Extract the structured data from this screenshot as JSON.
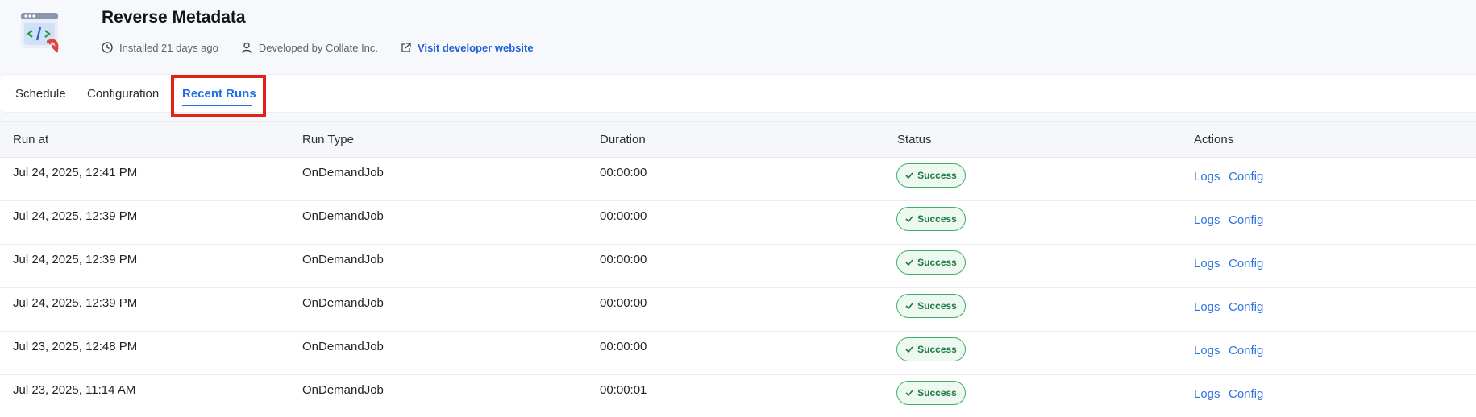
{
  "app": {
    "title": "Reverse Metadata",
    "installed": "Installed 21 days ago",
    "developer": "Developed by Collate Inc.",
    "website_link": "Visit developer website"
  },
  "tabs": [
    {
      "label": "Schedule"
    },
    {
      "label": "Configuration"
    },
    {
      "label": "Recent Runs",
      "active": true
    }
  ],
  "table": {
    "headers": [
      "Run at",
      "Run Type",
      "Duration",
      "Status",
      "Actions"
    ],
    "rows": [
      {
        "run_at": "Jul 24, 2025, 12:41 PM",
        "run_type": "OnDemandJob",
        "duration": "00:00:00",
        "status": "Success"
      },
      {
        "run_at": "Jul 24, 2025, 12:39 PM",
        "run_type": "OnDemandJob",
        "duration": "00:00:00",
        "status": "Success"
      },
      {
        "run_at": "Jul 24, 2025, 12:39 PM",
        "run_type": "OnDemandJob",
        "duration": "00:00:00",
        "status": "Success"
      },
      {
        "run_at": "Jul 24, 2025, 12:39 PM",
        "run_type": "OnDemandJob",
        "duration": "00:00:00",
        "status": "Success"
      },
      {
        "run_at": "Jul 23, 2025, 12:48 PM",
        "run_type": "OnDemandJob",
        "duration": "00:00:00",
        "status": "Success"
      },
      {
        "run_at": "Jul 23, 2025, 11:14 AM",
        "run_type": "OnDemandJob",
        "duration": "00:00:01",
        "status": "Success"
      }
    ],
    "actions": {
      "logs": "Logs",
      "config": "Config"
    }
  },
  "colors": {
    "accent": "#1f6fe5",
    "success": "#1f7a45",
    "highlight": "#e32119"
  }
}
